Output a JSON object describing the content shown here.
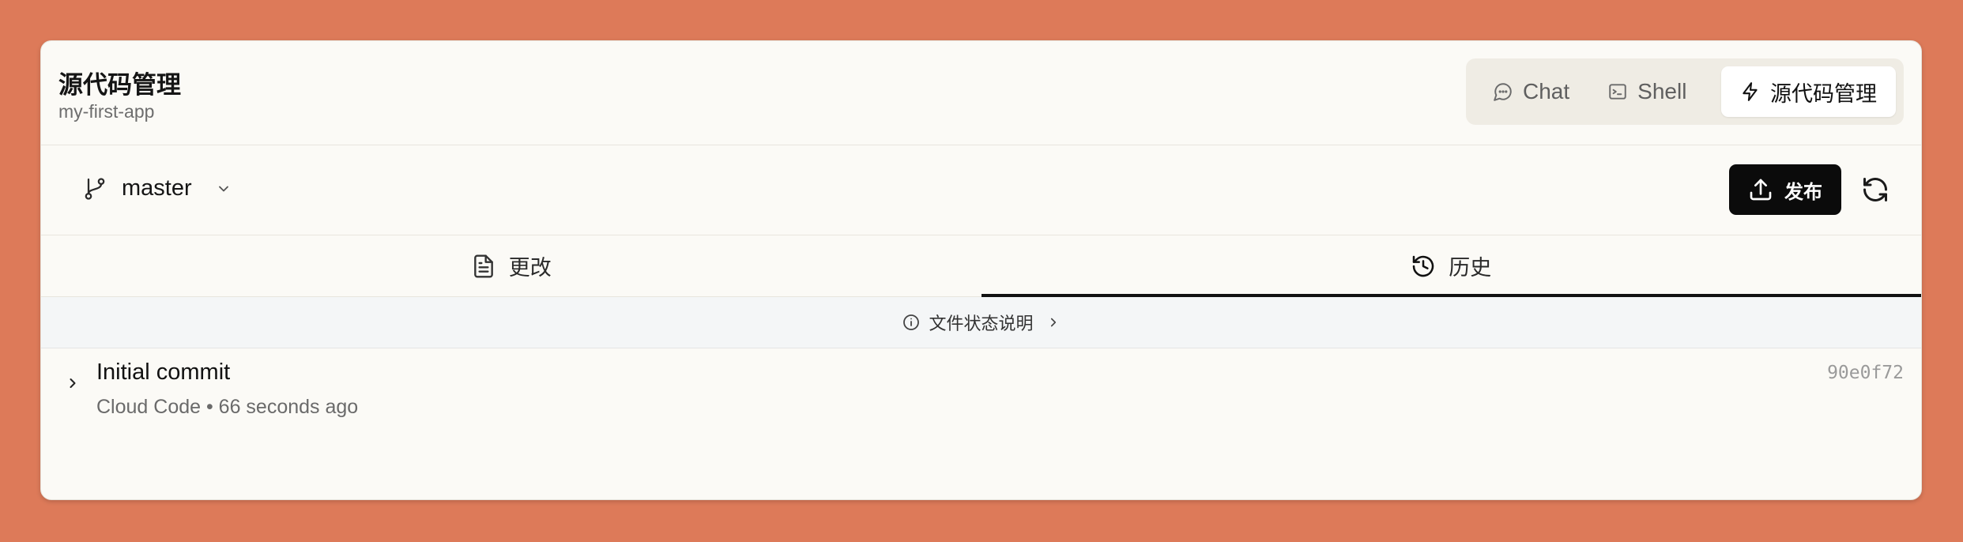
{
  "header": {
    "title": "源代码管理",
    "subtitle": "my-first-app",
    "mode_tabs": [
      {
        "label": "Chat",
        "icon": "chat-bubble-icon"
      },
      {
        "label": "Shell",
        "icon": "terminal-icon"
      },
      {
        "label": "源代码管理",
        "icon": "lightning-icon",
        "active": true
      }
    ]
  },
  "branch_bar": {
    "branch": "master",
    "publish_label": "发布"
  },
  "tabs": [
    {
      "label": "更改",
      "icon": "file-icon"
    },
    {
      "label": "历史",
      "icon": "history-icon",
      "active": true
    }
  ],
  "info_bar": {
    "label": "文件状态说明"
  },
  "commits": [
    {
      "message": "Initial commit",
      "meta": "Cloud Code • 66 seconds ago",
      "hash": "90e0f72"
    }
  ],
  "colors": {
    "background": "#dd7a59",
    "card": "#fbfaf6",
    "publish_button": "#0b0b0b"
  }
}
